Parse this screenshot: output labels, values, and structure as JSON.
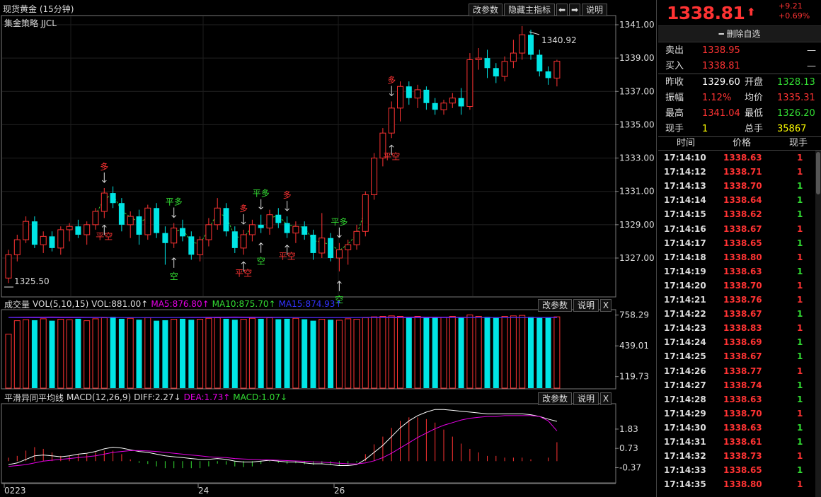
{
  "main_chart": {
    "title": "现货黄金 (15分钟)",
    "strategy": "集金策略 JJCL",
    "buttons": [
      "改参数",
      "隐藏主指标",
      "⬅",
      "➡",
      "说明"
    ],
    "y_ticks": [
      "1341.00",
      "1339.00",
      "1337.00",
      "1335.00",
      "1333.00",
      "1331.00",
      "1329.00",
      "1327.00"
    ],
    "high_label": "1340.92",
    "low_label": "1325.50",
    "signals": [
      {
        "text": "多",
        "color": "#ff3333"
      },
      {
        "text": "平空",
        "color": "#ff3333"
      },
      {
        "text": "平多",
        "color": "#33dd33"
      },
      {
        "text": "空",
        "color": "#33dd33"
      },
      {
        "text": "多",
        "color": "#ff3333"
      },
      {
        "text": "平空",
        "color": "#ff3333"
      },
      {
        "text": "平多",
        "color": "#33dd33"
      },
      {
        "text": "空",
        "color": "#33dd33"
      },
      {
        "text": "多",
        "color": "#ff3333"
      },
      {
        "text": "平空",
        "color": "#ff3333"
      },
      {
        "text": "平多",
        "color": "#33dd33"
      },
      {
        "text": "空",
        "color": "#33dd33"
      },
      {
        "text": "多",
        "color": "#ff3333"
      },
      {
        "text": "平空",
        "color": "#ff3333"
      }
    ]
  },
  "volume_chart": {
    "label": "成交量",
    "vol": "VOL(5,10,15)  VOL:881.00↑",
    "ma5": "MA5:876.80↑",
    "ma10": "MA10:875.70↑",
    "ma15": "MA15:874.93↑",
    "buttons": [
      "改参数",
      "说明",
      "X"
    ],
    "y_ticks": [
      "758.29",
      "439.01",
      "119.73"
    ]
  },
  "macd_chart": {
    "label": "平滑异同平均线",
    "params": "MACD(12,26,9)",
    "diff": "DIFF:2.27↓",
    "dea": "DEA:1.73↑",
    "macd": "MACD:1.07↓",
    "buttons": [
      "改参数",
      "说明",
      "X"
    ],
    "y_ticks": [
      "1.83",
      "0.73",
      "-0.37"
    ]
  },
  "x_axis": [
    "0223",
    "24",
    "26"
  ],
  "colors": {
    "up": "#ff3333",
    "down": "#00e5e5",
    "white_line": "#ffffff",
    "magenta_line": "#e600e6",
    "green": "#33dd33",
    "yellow": "#ffff00"
  },
  "chart_data": {
    "type": "candlestick",
    "interval": "15分钟",
    "ylim": [
      1325.5,
      1341.0
    ],
    "candles": [
      [
        1325.8,
        1327.5,
        1325.5,
        1327.2
      ],
      [
        1327.2,
        1328.4,
        1326.8,
        1328.1
      ],
      [
        1328.1,
        1329.5,
        1327.9,
        1329.2
      ],
      [
        1329.2,
        1329.5,
        1327.6,
        1327.8
      ],
      [
        1327.8,
        1328.6,
        1327.3,
        1328.3
      ],
      [
        1328.3,
        1328.6,
        1327.4,
        1327.6
      ],
      [
        1327.6,
        1328.9,
        1327.2,
        1328.7
      ],
      [
        1328.7,
        1329.1,
        1328.0,
        1328.9
      ],
      [
        1328.9,
        1329.3,
        1328.2,
        1328.4
      ],
      [
        1328.4,
        1329.2,
        1327.8,
        1329.0
      ],
      [
        1329.0,
        1330.0,
        1328.7,
        1329.8
      ],
      [
        1329.8,
        1331.2,
        1329.4,
        1330.9
      ],
      [
        1330.9,
        1331.3,
        1330.0,
        1330.3
      ],
      [
        1330.3,
        1330.6,
        1328.6,
        1329.0
      ],
      [
        1329.0,
        1329.8,
        1328.2,
        1329.5
      ],
      [
        1329.5,
        1329.9,
        1327.8,
        1328.4
      ],
      [
        1328.4,
        1330.2,
        1328.1,
        1330.0
      ],
      [
        1330.0,
        1330.3,
        1328.2,
        1328.5
      ],
      [
        1328.5,
        1328.9,
        1326.6,
        1327.9
      ],
      [
        1327.9,
        1329.1,
        1327.6,
        1328.8
      ],
      [
        1328.8,
        1329.3,
        1328.0,
        1328.3
      ],
      [
        1328.3,
        1328.6,
        1326.9,
        1327.2
      ],
      [
        1327.2,
        1328.3,
        1326.8,
        1328.1
      ],
      [
        1328.1,
        1329.4,
        1327.7,
        1329.0
      ],
      [
        1329.0,
        1330.6,
        1328.7,
        1330.0
      ],
      [
        1330.0,
        1330.3,
        1328.3,
        1328.6
      ],
      [
        1328.6,
        1328.9,
        1327.3,
        1327.6
      ],
      [
        1327.6,
        1328.7,
        1327.2,
        1328.4
      ],
      [
        1328.4,
        1329.3,
        1328.0,
        1329.0
      ],
      [
        1329.0,
        1329.6,
        1328.5,
        1328.8
      ],
      [
        1328.8,
        1329.9,
        1328.4,
        1329.6
      ],
      [
        1329.6,
        1330.0,
        1328.8,
        1329.1
      ],
      [
        1329.1,
        1329.5,
        1328.2,
        1328.5
      ],
      [
        1328.5,
        1329.2,
        1327.9,
        1328.9
      ],
      [
        1328.9,
        1329.2,
        1328.1,
        1328.4
      ],
      [
        1328.4,
        1328.7,
        1326.9,
        1327.3
      ],
      [
        1327.3,
        1329.7,
        1327.0,
        1328.2
      ],
      [
        1328.2,
        1328.5,
        1326.8,
        1327.0
      ],
      [
        1327.0,
        1327.9,
        1326.2,
        1327.5
      ],
      [
        1327.5,
        1328.1,
        1326.6,
        1327.8
      ],
      [
        1327.8,
        1329.0,
        1327.5,
        1328.6
      ],
      [
        1328.6,
        1331.0,
        1328.3,
        1330.8
      ],
      [
        1330.8,
        1333.3,
        1330.5,
        1333.0
      ],
      [
        1333.0,
        1334.8,
        1332.5,
        1334.5
      ],
      [
        1334.5,
        1336.4,
        1334.2,
        1336.0
      ],
      [
        1336.0,
        1337.6,
        1335.2,
        1337.3
      ],
      [
        1337.3,
        1337.6,
        1336.2,
        1336.6
      ],
      [
        1336.6,
        1337.4,
        1336.0,
        1337.1
      ],
      [
        1337.1,
        1337.3,
        1335.9,
        1336.3
      ],
      [
        1336.3,
        1336.6,
        1335.6,
        1335.9
      ],
      [
        1335.9,
        1336.5,
        1335.6,
        1336.3
      ],
      [
        1336.3,
        1336.9,
        1336.0,
        1336.6
      ],
      [
        1336.6,
        1337.2,
        1335.6,
        1336.1
      ],
      [
        1336.1,
        1339.3,
        1335.9,
        1338.9
      ],
      [
        1338.9,
        1339.6,
        1338.3,
        1339.0
      ],
      [
        1339.0,
        1339.5,
        1337.8,
        1338.4
      ],
      [
        1338.4,
        1338.7,
        1337.5,
        1337.9
      ],
      [
        1337.9,
        1339.1,
        1337.6,
        1338.8
      ],
      [
        1338.8,
        1340.1,
        1338.4,
        1339.3
      ],
      [
        1339.3,
        1340.92,
        1338.9,
        1340.4
      ],
      [
        1340.4,
        1340.7,
        1338.9,
        1339.2
      ],
      [
        1339.2,
        1339.5,
        1337.9,
        1338.2
      ],
      [
        1338.2,
        1338.5,
        1337.4,
        1337.8
      ],
      [
        1337.8,
        1338.9,
        1337.3,
        1338.81
      ]
    ],
    "volume": [
      560,
      700,
      710,
      705,
      720,
      700,
      715,
      710,
      720,
      700,
      720,
      730,
      740,
      720,
      725,
      710,
      730,
      700,
      705,
      715,
      720,
      710,
      715,
      725,
      730,
      720,
      710,
      715,
      725,
      720,
      730,
      715,
      720,
      725,
      715,
      700,
      715,
      710,
      705,
      720,
      715,
      730,
      740,
      745,
      750,
      745,
      735,
      745,
      735,
      740,
      735,
      745,
      735,
      760,
      745,
      740,
      735,
      745,
      750,
      755,
      740,
      735,
      730,
      740
    ],
    "macd_diff": [
      -0.2,
      -0.1,
      0.1,
      0.3,
      0.35,
      0.3,
      0.25,
      0.3,
      0.4,
      0.45,
      0.55,
      0.7,
      0.8,
      0.75,
      0.65,
      0.55,
      0.5,
      0.4,
      0.3,
      0.25,
      0.2,
      0.15,
      0.1,
      0.1,
      0.15,
      0.1,
      0.0,
      -0.05,
      -0.05,
      0.0,
      0.05,
      0.0,
      -0.05,
      -0.05,
      -0.1,
      -0.15,
      -0.15,
      -0.2,
      -0.25,
      -0.25,
      -0.2,
      0.1,
      0.5,
      0.9,
      1.4,
      1.9,
      2.3,
      2.6,
      2.8,
      2.95,
      2.95,
      2.9,
      2.85,
      2.8,
      2.75,
      2.7,
      2.7,
      2.7,
      2.7,
      2.7,
      2.65,
      2.55,
      2.4,
      2.27
    ],
    "macd_dea": [
      -0.3,
      -0.25,
      -0.2,
      -0.1,
      0.0,
      0.05,
      0.1,
      0.15,
      0.2,
      0.25,
      0.3,
      0.4,
      0.5,
      0.55,
      0.6,
      0.6,
      0.58,
      0.55,
      0.5,
      0.45,
      0.4,
      0.35,
      0.3,
      0.25,
      0.22,
      0.2,
      0.15,
      0.12,
      0.1,
      0.08,
      0.07,
      0.05,
      0.03,
      0.01,
      -0.01,
      -0.04,
      -0.06,
      -0.09,
      -0.12,
      -0.15,
      -0.16,
      -0.1,
      0.02,
      0.2,
      0.45,
      0.75,
      1.05,
      1.35,
      1.6,
      1.85,
      2.05,
      2.2,
      2.35,
      2.45,
      2.5,
      2.55,
      2.55,
      2.6,
      2.6,
      2.6,
      2.6,
      2.55,
      2.3,
      1.73
    ]
  },
  "quote_panel": {
    "price": "1338.81",
    "change": "+9.21",
    "change_pct": "+0.69%",
    "delete_btn": "━ 删除自选",
    "sell_label": "卖出",
    "sell_price": "1338.95",
    "sell_vol": "—",
    "buy_label": "买入",
    "buy_price": "1338.81",
    "buy_vol": "—",
    "rows": [
      {
        "l1": "昨收",
        "v1": "1329.60",
        "c1": "#ffffff",
        "l2": "开盘",
        "v2": "1328.13",
        "c2": "#33dd33"
      },
      {
        "l1": "振幅",
        "v1": "1.12%",
        "c1": "#ff3333",
        "l2": "均价",
        "v2": "1335.31",
        "c2": "#ff3333"
      },
      {
        "l1": "最高",
        "v1": "1341.04",
        "c1": "#ff3333",
        "l2": "最低",
        "v2": "1326.20",
        "c2": "#33dd33"
      },
      {
        "l1": "现手",
        "v1": "1",
        "c1": "#ffff00",
        "l2": "总手",
        "v2": "35867",
        "c2": "#ffff00"
      }
    ],
    "tick_header": {
      "time": "时间",
      "price": "价格",
      "vol": "现手"
    },
    "ticks": [
      {
        "time": "17:14:10",
        "price": "1338.63",
        "vol": "1",
        "vc": "#ff3333"
      },
      {
        "time": "17:14:12",
        "price": "1338.71",
        "vol": "1",
        "vc": "#ff3333"
      },
      {
        "time": "17:14:13",
        "price": "1338.70",
        "vol": "1",
        "vc": "#33dd33"
      },
      {
        "time": "17:14:14",
        "price": "1338.64",
        "vol": "1",
        "vc": "#33dd33"
      },
      {
        "time": "17:14:15",
        "price": "1338.62",
        "vol": "1",
        "vc": "#33dd33"
      },
      {
        "time": "17:14:16",
        "price": "1338.67",
        "vol": "1",
        "vc": "#ff3333"
      },
      {
        "time": "17:14:17",
        "price": "1338.65",
        "vol": "1",
        "vc": "#33dd33"
      },
      {
        "time": "17:14:18",
        "price": "1338.80",
        "vol": "1",
        "vc": "#ff3333"
      },
      {
        "time": "17:14:19",
        "price": "1338.63",
        "vol": "1",
        "vc": "#33dd33"
      },
      {
        "time": "17:14:20",
        "price": "1338.70",
        "vol": "1",
        "vc": "#ff3333"
      },
      {
        "time": "17:14:21",
        "price": "1338.76",
        "vol": "1",
        "vc": "#ff3333"
      },
      {
        "time": "17:14:22",
        "price": "1338.67",
        "vol": "1",
        "vc": "#33dd33"
      },
      {
        "time": "17:14:23",
        "price": "1338.83",
        "vol": "1",
        "vc": "#ff3333"
      },
      {
        "time": "17:14:24",
        "price": "1338.69",
        "vol": "1",
        "vc": "#33dd33"
      },
      {
        "time": "17:14:25",
        "price": "1338.67",
        "vol": "1",
        "vc": "#33dd33"
      },
      {
        "time": "17:14:26",
        "price": "1338.77",
        "vol": "1",
        "vc": "#ff3333"
      },
      {
        "time": "17:14:27",
        "price": "1338.74",
        "vol": "1",
        "vc": "#33dd33"
      },
      {
        "time": "17:14:28",
        "price": "1338.63",
        "vol": "1",
        "vc": "#33dd33"
      },
      {
        "time": "17:14:29",
        "price": "1338.70",
        "vol": "1",
        "vc": "#ff3333"
      },
      {
        "time": "17:14:30",
        "price": "1338.63",
        "vol": "1",
        "vc": "#33dd33"
      },
      {
        "time": "17:14:31",
        "price": "1338.61",
        "vol": "1",
        "vc": "#33dd33"
      },
      {
        "time": "17:14:32",
        "price": "1338.73",
        "vol": "1",
        "vc": "#ff3333"
      },
      {
        "time": "17:14:33",
        "price": "1338.65",
        "vol": "1",
        "vc": "#33dd33"
      },
      {
        "time": "17:14:35",
        "price": "1338.80",
        "vol": "1",
        "vc": "#ff3333"
      }
    ]
  }
}
